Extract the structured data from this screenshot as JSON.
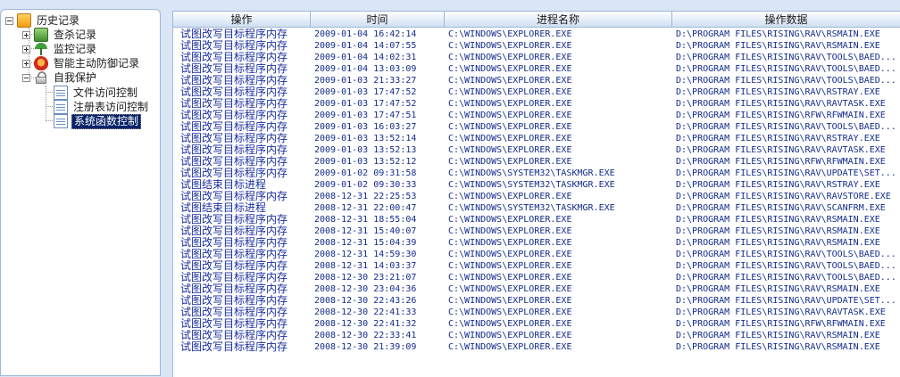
{
  "tree": {
    "root_label": "历史记录",
    "items": [
      {
        "label": "查杀记录"
      },
      {
        "label": "监控记录"
      },
      {
        "label": "智能主动防御记录"
      },
      {
        "label": "自我保护"
      }
    ],
    "sub_items": [
      {
        "label": "文件访问控制"
      },
      {
        "label": "注册表访问控制"
      },
      {
        "label": "系统函数控制"
      }
    ]
  },
  "table": {
    "columns": [
      "操作",
      "时间",
      "进程名称",
      "操作数据"
    ],
    "rows": [
      [
        "试图改写目标程序内存",
        "2009-01-04 16:42:14",
        "C:\\WINDOWS\\EXPLORER.EXE",
        "D:\\PROGRAM FILES\\RISING\\RAV\\RSMAIN.EXE"
      ],
      [
        "试图改写目标程序内存",
        "2009-01-04 14:07:55",
        "C:\\WINDOWS\\EXPLORER.EXE",
        "D:\\PROGRAM FILES\\RISING\\RAV\\RSMAIN.EXE"
      ],
      [
        "试图改写目标程序内存",
        "2009-01-04 14:02:31",
        "C:\\WINDOWS\\EXPLORER.EXE",
        "D:\\PROGRAM FILES\\RISING\\RAV\\TOOLS\\BAED..."
      ],
      [
        "试图改写目标程序内存",
        "2009-01-04 13:03:09",
        "C:\\WINDOWS\\EXPLORER.EXE",
        "D:\\PROGRAM FILES\\RISING\\RAV\\TOOLS\\BAED..."
      ],
      [
        "试图改写目标程序内存",
        "2009-01-03 21:33:27",
        "C:\\WINDOWS\\EXPLORER.EXE",
        "D:\\PROGRAM FILES\\RISING\\RAV\\TOOLS\\BAED..."
      ],
      [
        "试图改写目标程序内存",
        "2009-01-03 17:47:52",
        "C:\\WINDOWS\\EXPLORER.EXE",
        "D:\\PROGRAM FILES\\RISING\\RAV\\RSTRAY.EXE"
      ],
      [
        "试图改写目标程序内存",
        "2009-01-03 17:47:52",
        "C:\\WINDOWS\\EXPLORER.EXE",
        "D:\\PROGRAM FILES\\RISING\\RAV\\RAVTASK.EXE"
      ],
      [
        "试图改写目标程序内存",
        "2009-01-03 17:47:51",
        "C:\\WINDOWS\\EXPLORER.EXE",
        "D:\\PROGRAM FILES\\RISING\\RFW\\RFWMAIN.EXE"
      ],
      [
        "试图改写目标程序内存",
        "2009-01-03 16:03:27",
        "C:\\WINDOWS\\EXPLORER.EXE",
        "D:\\PROGRAM FILES\\RISING\\RAV\\TOOLS\\BAED..."
      ],
      [
        "试图改写目标程序内存",
        "2009-01-03 13:52:14",
        "C:\\WINDOWS\\EXPLORER.EXE",
        "D:\\PROGRAM FILES\\RISING\\RAV\\RSTRAY.EXE"
      ],
      [
        "试图改写目标程序内存",
        "2009-01-03 13:52:13",
        "C:\\WINDOWS\\EXPLORER.EXE",
        "D:\\PROGRAM FILES\\RISING\\RAV\\RAVTASK.EXE"
      ],
      [
        "试图改写目标程序内存",
        "2009-01-03 13:52:12",
        "C:\\WINDOWS\\EXPLORER.EXE",
        "D:\\PROGRAM FILES\\RISING\\RFW\\RFWMAIN.EXE"
      ],
      [
        "试图改写目标程序内存",
        "2009-01-02 09:31:58",
        "C:\\WINDOWS\\SYSTEM32\\TASKMGR.EXE",
        "D:\\PROGRAM FILES\\RISING\\RAV\\UPDATE\\SET..."
      ],
      [
        "试图结束目标进程",
        "2009-01-02 09:30:33",
        "C:\\WINDOWS\\SYSTEM32\\TASKMGR.EXE",
        "D:\\PROGRAM FILES\\RISING\\RAV\\RSTRAY.EXE"
      ],
      [
        "试图改写目标程序内存",
        "2008-12-31 22:25:53",
        "C:\\WINDOWS\\EXPLORER.EXE",
        "D:\\PROGRAM FILES\\RISING\\RAV\\RAVSTORE.EXE"
      ],
      [
        "试图结束目标进程",
        "2008-12-31 22:00:47",
        "C:\\WINDOWS\\SYSTEM32\\TASKMGR.EXE",
        "D:\\PROGRAM FILES\\RISING\\RAV\\SCANFRM.EXE"
      ],
      [
        "试图改写目标程序内存",
        "2008-12-31 18:55:04",
        "C:\\WINDOWS\\EXPLORER.EXE",
        "D:\\PROGRAM FILES\\RISING\\RAV\\RSMAIN.EXE"
      ],
      [
        "试图改写目标程序内存",
        "2008-12-31 15:40:07",
        "C:\\WINDOWS\\EXPLORER.EXE",
        "D:\\PROGRAM FILES\\RISING\\RAV\\RSMAIN.EXE"
      ],
      [
        "试图改写目标程序内存",
        "2008-12-31 15:04:39",
        "C:\\WINDOWS\\EXPLORER.EXE",
        "D:\\PROGRAM FILES\\RISING\\RAV\\RSMAIN.EXE"
      ],
      [
        "试图改写目标程序内存",
        "2008-12-31 14:59:30",
        "C:\\WINDOWS\\EXPLORER.EXE",
        "D:\\PROGRAM FILES\\RISING\\RAV\\TOOLS\\BAED..."
      ],
      [
        "试图改写目标程序内存",
        "2008-12-31 14:03:37",
        "C:\\WINDOWS\\EXPLORER.EXE",
        "D:\\PROGRAM FILES\\RISING\\RAV\\TOOLS\\BAED..."
      ],
      [
        "试图改写目标程序内存",
        "2008-12-30 23:21:07",
        "C:\\WINDOWS\\EXPLORER.EXE",
        "D:\\PROGRAM FILES\\RISING\\RAV\\TOOLS\\BAED..."
      ],
      [
        "试图改写目标程序内存",
        "2008-12-30 23:04:36",
        "C:\\WINDOWS\\EXPLORER.EXE",
        "D:\\PROGRAM FILES\\RISING\\RAV\\RSMAIN.EXE"
      ],
      [
        "试图改写目标程序内存",
        "2008-12-30 22:43:26",
        "C:\\WINDOWS\\EXPLORER.EXE",
        "D:\\PROGRAM FILES\\RISING\\RAV\\UPDATE\\SET..."
      ],
      [
        "试图改写目标程序内存",
        "2008-12-30 22:41:33",
        "C:\\WINDOWS\\EXPLORER.EXE",
        "D:\\PROGRAM FILES\\RISING\\RAV\\RAVTASK.EXE"
      ],
      [
        "试图改写目标程序内存",
        "2008-12-30 22:41:32",
        "C:\\WINDOWS\\EXPLORER.EXE",
        "D:\\PROGRAM FILES\\RISING\\RFW\\RFWMAIN.EXE"
      ],
      [
        "试图改写目标程序内存",
        "2008-12-30 22:33:41",
        "C:\\WINDOWS\\EXPLORER.EXE",
        "D:\\PROGRAM FILES\\RISING\\RAV\\RSMAIN.EXE"
      ],
      [
        "试图改写目标程序内存",
        "2008-12-30 21:39:09",
        "C:\\WINDOWS\\EXPLORER.EXE",
        "D:\\PROGRAM FILES\\RISING\\RAV\\RSMAIN.EXE"
      ]
    ]
  }
}
